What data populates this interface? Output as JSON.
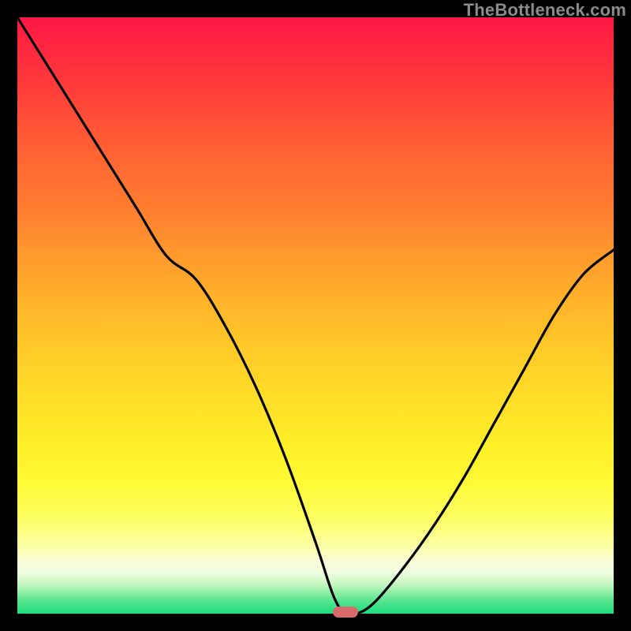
{
  "watermark": "TheBottleneck.com",
  "marker": {
    "x_pct": 55,
    "y_pct": 100
  },
  "chart_data": {
    "type": "line",
    "title": "",
    "xlabel": "",
    "ylabel": "",
    "xlim": [
      0,
      100
    ],
    "ylim": [
      0,
      100
    ],
    "grid": false,
    "legend": false,
    "background_gradient": {
      "top": "#ff1744",
      "mid": "#ffe028",
      "bottom": "#1cdd7c"
    },
    "series": [
      {
        "name": "bottleneck-curve",
        "color": "#000000",
        "x": [
          0,
          5,
          10,
          15,
          20,
          25,
          30,
          35,
          40,
          45,
          50,
          53,
          55,
          57,
          60,
          65,
          70,
          75,
          80,
          85,
          90,
          95,
          100
        ],
        "y": [
          100,
          92,
          84,
          76,
          68,
          60,
          56,
          48,
          38,
          26,
          12,
          3,
          0,
          0,
          2,
          8,
          15,
          23,
          32,
          41,
          50,
          57,
          61
        ]
      }
    ],
    "marker": {
      "x": 55,
      "y": 0,
      "color": "#d86a68"
    }
  }
}
